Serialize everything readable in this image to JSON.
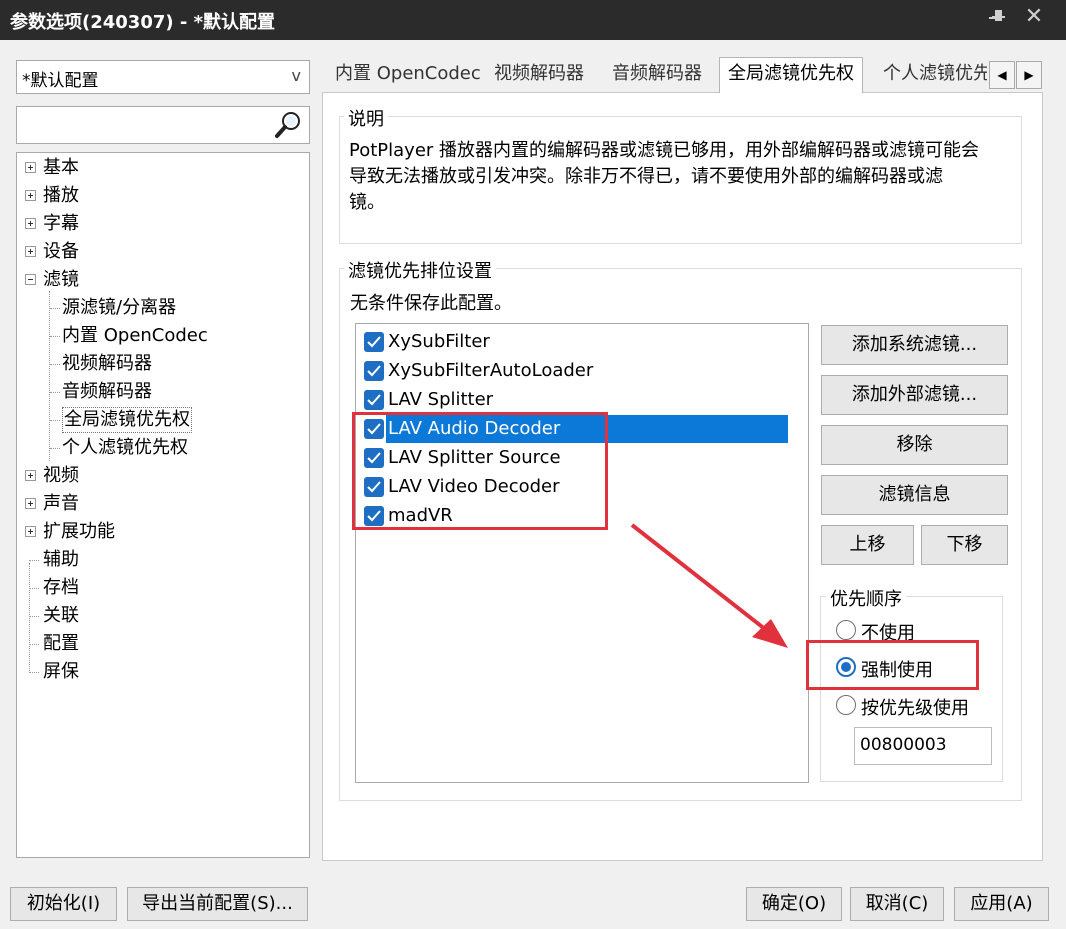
{
  "window": {
    "title": "参数选项(240307) - *默认配置"
  },
  "sidebar": {
    "profile": "*默认配置",
    "search_placeholder": "",
    "tree": [
      {
        "label": "基本",
        "expander": "plus"
      },
      {
        "label": "播放",
        "expander": "plus"
      },
      {
        "label": "字幕",
        "expander": "plus"
      },
      {
        "label": "设备",
        "expander": "plus"
      },
      {
        "label": "滤镜",
        "expander": "minus"
      },
      {
        "label": "源滤镜/分离器"
      },
      {
        "label": "内置 OpenCodec"
      },
      {
        "label": "视频解码器"
      },
      {
        "label": "音频解码器"
      },
      {
        "label": "全局滤镜优先权",
        "selected": true
      },
      {
        "label": "个人滤镜优先权"
      },
      {
        "label": "视频",
        "expander": "plus"
      },
      {
        "label": "声音",
        "expander": "plus"
      },
      {
        "label": "扩展功能",
        "expander": "plus"
      },
      {
        "label": "辅助"
      },
      {
        "label": "存档"
      },
      {
        "label": "关联"
      },
      {
        "label": "配置"
      },
      {
        "label": "屏保"
      }
    ]
  },
  "tabs": [
    {
      "label": "内置 OpenCodec"
    },
    {
      "label": "视频解码器"
    },
    {
      "label": "音频解码器"
    },
    {
      "label": "全局滤镜优先权",
      "active": true
    },
    {
      "label": "个人滤镜优先"
    }
  ],
  "description": {
    "title": "说明",
    "lines": [
      "PotPlayer 播放器内置的编解码器或滤镜已够用，用外部编解码器或滤镜可能会",
      "导致无法播放或引发冲突。除非万不得已，请不要使用外部的编解码器或滤",
      "镜。"
    ]
  },
  "priority_settings": {
    "title": "滤镜优先排位设置",
    "subtitle": "无条件保存此配置。",
    "filters": [
      {
        "name": "XySubFilter",
        "checked": true
      },
      {
        "name": "XySubFilterAutoLoader",
        "checked": true
      },
      {
        "name": "LAV Splitter",
        "checked": true
      },
      {
        "name": "LAV Audio Decoder",
        "checked": true,
        "selected": true
      },
      {
        "name": "LAV Splitter Source",
        "checked": true
      },
      {
        "name": "LAV Video Decoder",
        "checked": true
      },
      {
        "name": "madVR",
        "checked": true
      }
    ],
    "buttons": {
      "add_system": "添加系统滤镜...",
      "add_external": "添加外部滤镜...",
      "remove": "移除",
      "info": "滤镜信息",
      "move_up": "上移",
      "move_down": "下移"
    },
    "order": {
      "title": "优先顺序",
      "options": [
        "不使用",
        "强制使用",
        "按优先级使用"
      ],
      "selected": "强制使用",
      "value": "00800003"
    }
  },
  "footer": {
    "init": "初始化(I)",
    "export": "导出当前配置(S)...",
    "ok": "确定(O)",
    "cancel": "取消(C)",
    "apply": "应用(A)"
  },
  "colors": {
    "titlebar": "#2b2b2b",
    "accent": "#1e6fc3",
    "selection": "#0c78d8",
    "annotation": "#e0313c"
  }
}
